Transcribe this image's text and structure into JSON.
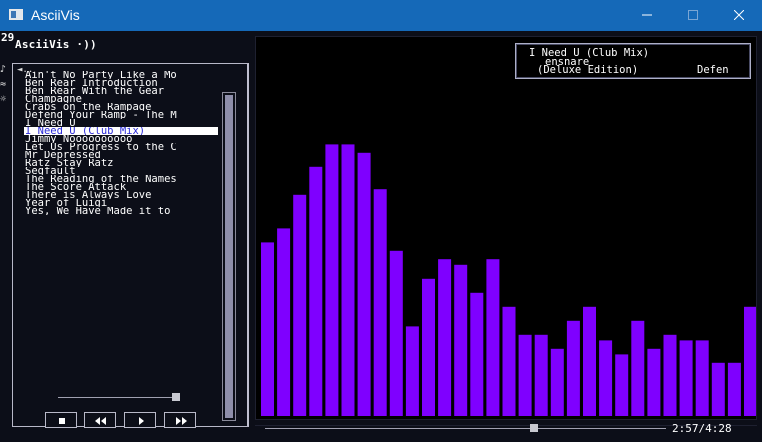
{
  "window": {
    "title": "AsciiVis",
    "minimize_glyph": "—",
    "maximize_glyph": "☐"
  },
  "console": {
    "counter": "29",
    "app_name": "AsciiVis ·))"
  },
  "side_icons": [
    "♪",
    "≈",
    "☼"
  ],
  "playlist": {
    "back_glyph": "◄..",
    "selected_index": 7,
    "songs": [
      "Ain't No Party Like a Mo",
      "Ben Rear Introduction",
      "Ben Rear With the Gear",
      "Champagne",
      "Crabs on the Rampage",
      "Defend Your Ramp - The M",
      "I Need U",
      "I Need U (Club Mix)",
      "Jimmy Noooooooooo",
      "Let Us Progress to the C",
      "Mr Depressed",
      "Ratz Stay Ratz",
      "Segfault",
      "The Reading of the Names",
      "The Score Attack",
      "There is Always Love",
      "Year of Luigi",
      "Yes, We Have Made it to"
    ]
  },
  "volume_level": 0.97,
  "controls": [
    "stop",
    "rewind",
    "play",
    "fast-forward"
  ],
  "now_playing": {
    "title": "I Need U (Club Mix)",
    "artist": "ensnare",
    "album": "(Deluxe Edition)",
    "extra": "Defen"
  },
  "spectrum": {
    "color": "#7f00ff",
    "max_level": 100,
    "levels": [
      62,
      67,
      79,
      89,
      97,
      97,
      94,
      81,
      59,
      32,
      49,
      56,
      54,
      44,
      56,
      39,
      29,
      29,
      24,
      34,
      39,
      27,
      22,
      34,
      24,
      29,
      27,
      27,
      19,
      19,
      39
    ]
  },
  "playback": {
    "position_fraction": 0.67,
    "time": "2:57/4:28"
  }
}
